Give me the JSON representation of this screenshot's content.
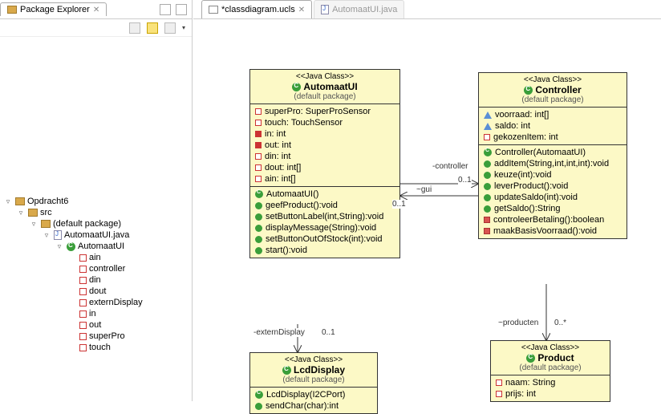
{
  "leftPanel": {
    "title": "Package Explorer",
    "tree": {
      "project": "Opdracht6",
      "src": "src",
      "pkg": "(default package)",
      "file": "AutomaatUI.java",
      "cls": "AutomaatUI",
      "fields": [
        "ain",
        "controller",
        "din",
        "dout",
        "externDisplay",
        "in",
        "out",
        "superPro",
        "touch"
      ]
    }
  },
  "editorTabs": {
    "active": "*classdiagram.ucls",
    "inactive": "AutomaatUI.java"
  },
  "uml": {
    "automaatUI": {
      "stereo": "<<Java Class>>",
      "name": "AutomaatUI",
      "pkg": "(default package)",
      "attrs": [
        {
          "vis": "priv",
          "text": "superPro: SuperProSensor"
        },
        {
          "vis": "priv",
          "text": "touch: TouchSensor"
        },
        {
          "vis": "default",
          "text": "in: int"
        },
        {
          "vis": "default",
          "text": "out: int"
        },
        {
          "vis": "priv",
          "text": "din: int"
        },
        {
          "vis": "priv",
          "text": "dout: int[]"
        },
        {
          "vis": "priv",
          "text": "ain: int[]"
        }
      ],
      "ops": [
        {
          "vis": "pubC",
          "text": "AutomaatUI()"
        },
        {
          "vis": "pub",
          "text": "geefProduct():void"
        },
        {
          "vis": "pub",
          "text": "setButtonLabel(int,String):void"
        },
        {
          "vis": "pub",
          "text": "displayMessage(String):void"
        },
        {
          "vis": "pub",
          "text": "setButtonOutOfStock(int):void"
        },
        {
          "vis": "pub",
          "text": "start():void"
        }
      ]
    },
    "controller": {
      "stereo": "<<Java Class>>",
      "name": "Controller",
      "pkg": "(default package)",
      "attrs": [
        {
          "vis": "tri",
          "text": "voorraad: int[]"
        },
        {
          "vis": "tri",
          "text": "saldo: int"
        },
        {
          "vis": "priv",
          "text": "gekozenItem: int"
        }
      ],
      "ops": [
        {
          "vis": "pubC",
          "text": "Controller(AutomaatUI)"
        },
        {
          "vis": "pub",
          "text": "addItem(String,int,int,int):void"
        },
        {
          "vis": "pub",
          "text": "keuze(int):void"
        },
        {
          "vis": "pub",
          "text": "leverProduct():void"
        },
        {
          "vis": "pub",
          "text": "updateSaldo(int):void"
        },
        {
          "vis": "pub",
          "text": "getSaldo():String"
        },
        {
          "vis": "privred",
          "text": "controleerBetaling():boolean"
        },
        {
          "vis": "privred",
          "text": "maakBasisVoorraad():void"
        }
      ]
    },
    "lcd": {
      "stereo": "<<Java Class>>",
      "name": "LcdDisplay",
      "pkg": "(default package)",
      "ops": [
        {
          "vis": "pubC",
          "text": "LcdDisplay(I2CPort)"
        },
        {
          "vis": "pub",
          "text": "sendChar(char):int"
        }
      ]
    },
    "product": {
      "stereo": "<<Java Class>>",
      "name": "Product",
      "pkg": "(default package)",
      "attrs": [
        {
          "vis": "priv",
          "text": "naam: String"
        },
        {
          "vis": "priv",
          "text": "prijs: int"
        }
      ]
    }
  },
  "assoc": {
    "guiLabel": "~gui",
    "guiCard": "0..1",
    "ctrlLabel": "-controller",
    "ctrlCard": "0..1",
    "extLabel": "-externDisplay",
    "extCard": "0..1",
    "prodLabel": "~producten",
    "prodCard": "0..*"
  }
}
